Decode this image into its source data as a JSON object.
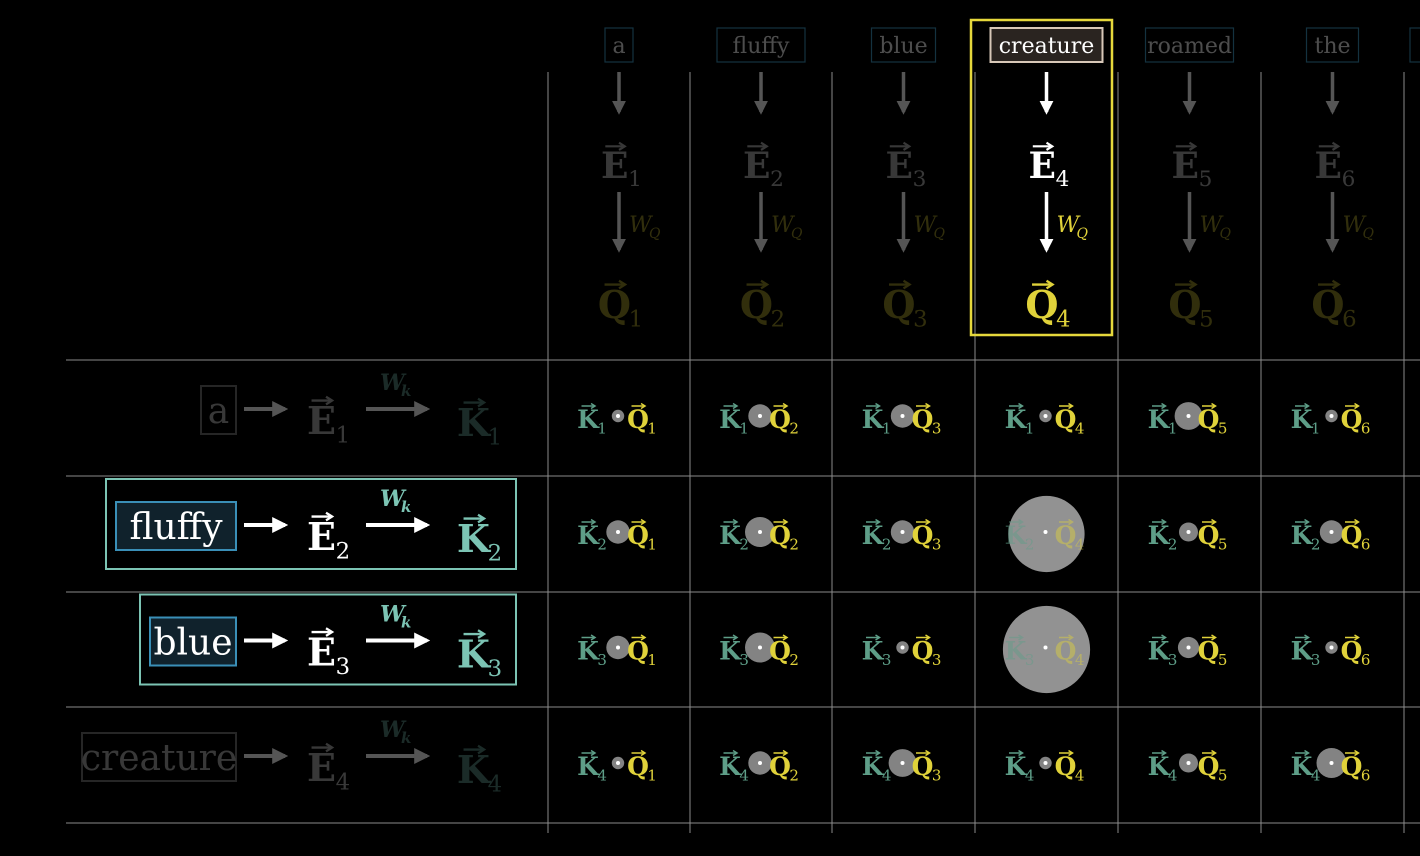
{
  "tokens": [
    "a",
    "fluffy",
    "blue",
    "creature",
    "roamed",
    "the"
  ],
  "highlighted_query_index": 3,
  "projection_labels": {
    "query": "W",
    "query_sub": "Q",
    "key": "W",
    "key_sub": "k"
  },
  "symbols": {
    "embedding": "E",
    "query": "Q",
    "key": "K",
    "dot": "·"
  },
  "query_indices": [
    "1",
    "2",
    "3",
    "4",
    "5",
    "6"
  ],
  "key_rows": [
    {
      "token": "a",
      "index": "1",
      "state": "dim"
    },
    {
      "token": "fluffy",
      "index": "2",
      "state": "active"
    },
    {
      "token": "blue",
      "index": "3",
      "state": "active"
    },
    {
      "token": "creature",
      "index": "4",
      "state": "dim"
    }
  ],
  "dot_products": [
    [
      0.1,
      0.35,
      0.35,
      0.1,
      0.45,
      0.1
    ],
    [
      0.35,
      0.5,
      0.35,
      1.55,
      0.25,
      0.35
    ],
    [
      0.35,
      0.5,
      0.1,
      1.8,
      0.3,
      0.1
    ],
    [
      0.1,
      0.35,
      0.45,
      0.1,
      0.25,
      0.5
    ]
  ],
  "colors": {
    "background": "#000000",
    "grid": "#8a8a8a",
    "query": "#e0d23a",
    "key": "#5e9e88",
    "key_box": "#7cc4b4",
    "token_box_active": "#3a8fb7",
    "highlight": "#e6d83c",
    "dot": "#9a9a9a",
    "text": "#ffffff"
  }
}
